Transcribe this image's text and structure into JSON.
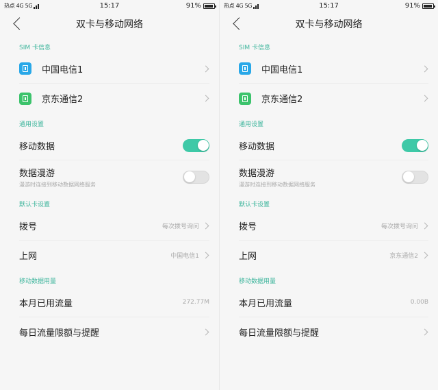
{
  "colors": {
    "accent": "#3db59c",
    "toggle_on": "#3ec9a7",
    "sim1": "#29a8e8",
    "sim2": "#3cc36c"
  },
  "screens": [
    {
      "status": {
        "left": "热点 4G 5G",
        "time": "15:17",
        "battery": "91%"
      },
      "title": "双卡与移动网络",
      "sim_section": "SIM 卡信息",
      "sim1": "中国电信1",
      "sim2": "京东通信2",
      "general_section": "通用设置",
      "mobile_data": "移动数据",
      "mobile_data_on": true,
      "roaming": "数据漫游",
      "roaming_sub": "漫游时连接到移动数据网络服务",
      "roaming_on": false,
      "default_section": "默认卡设置",
      "dial": "拨号",
      "dial_value": "每次拨号询问",
      "internet": "上网",
      "internet_value": "中国电信1",
      "usage_section": "移动数据用量",
      "monthly": "本月已用流量",
      "monthly_value": "272.77M",
      "daily": "每日流量限额与提醒"
    },
    {
      "status": {
        "left": "热点 4G 5G",
        "time": "15:17",
        "battery": "91%"
      },
      "title": "双卡与移动网络",
      "sim_section": "SIM 卡信息",
      "sim1": "中国电信1",
      "sim2": "京东通信2",
      "general_section": "通用设置",
      "mobile_data": "移动数据",
      "mobile_data_on": true,
      "roaming": "数据漫游",
      "roaming_sub": "漫游时连接到移动数据网络服务",
      "roaming_on": false,
      "default_section": "默认卡设置",
      "dial": "拨号",
      "dial_value": "每次拨号询问",
      "internet": "上网",
      "internet_value": "京东通信2",
      "usage_section": "移动数据用量",
      "monthly": "本月已用流量",
      "monthly_value": "0.00B",
      "daily": "每日流量限额与提醒"
    }
  ]
}
